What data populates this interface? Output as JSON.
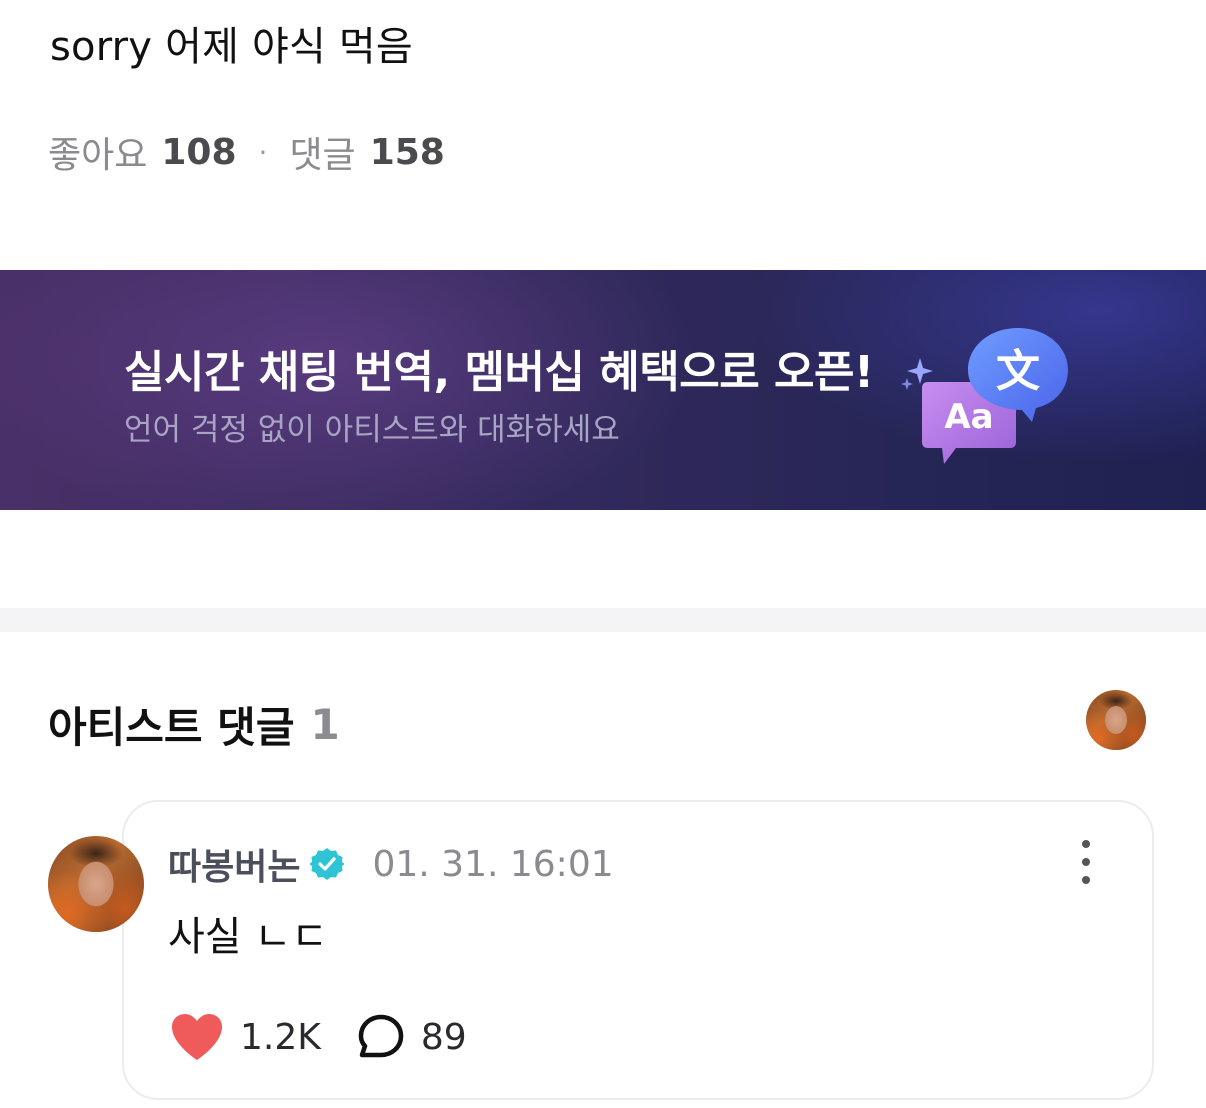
{
  "post": {
    "text": "sorry 어제 야식 먹음",
    "likes_label": "좋아요",
    "likes_count": "108",
    "separator": "·",
    "comments_label": "댓글",
    "comments_count": "158"
  },
  "banner": {
    "title": "실시간 채팅 번역, 멤버십 혜택으로 오픈!",
    "subtitle": "언어 걱정 없이 아티스트와 대화하세요",
    "icon_text_1": "文",
    "icon_text_2": "Aa"
  },
  "artist_comments": {
    "title": "아티스트 댓글",
    "count": "1"
  },
  "comment": {
    "author": "따봉버논",
    "timestamp": "01. 31. 16:01",
    "body": "사실 ㄴㄷ",
    "likes": "1.2K",
    "replies": "89"
  },
  "colors": {
    "heart": "#ef5a5a",
    "verified": "#2ec4d6",
    "banner_title": "#ffffff"
  }
}
